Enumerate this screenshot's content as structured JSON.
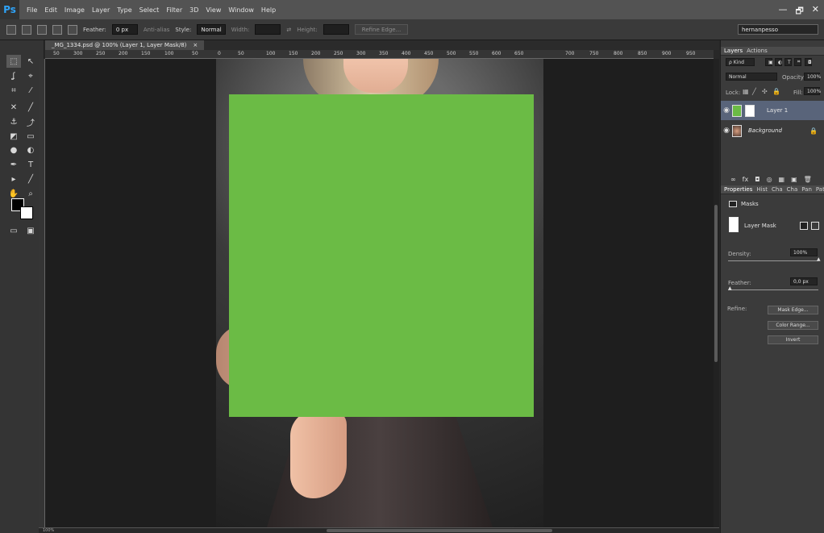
{
  "app": {
    "logo": "Ps",
    "menu": [
      "File",
      "Edit",
      "Image",
      "Layer",
      "Type",
      "Select",
      "Filter",
      "3D",
      "View",
      "Window",
      "Help"
    ],
    "window_controls": [
      "—",
      "🗗",
      "✕"
    ]
  },
  "options_bar": {
    "feather_label": "Feather:",
    "feather_value": "0 px",
    "anti_alias": "Anti-alias",
    "style_label": "Style:",
    "style_value": "Normal",
    "width_label": "Width:",
    "height_label": "Height:",
    "refine_edge": "Refine Edge...",
    "workspace": "hernanpesso"
  },
  "document": {
    "tab_title": "_MG_1334.psd @ 100% (Layer 1, Layer Mask/8)",
    "close": "×",
    "ruler_ticks": [
      "50",
      "300",
      "250",
      "200",
      "150",
      "100",
      "50",
      "0",
      "50",
      "100",
      "150",
      "200",
      "250",
      "300",
      "350",
      "400",
      "450",
      "500",
      "550",
      "600",
      "650",
      "700",
      "750",
      "800",
      "850",
      "900",
      "950"
    ],
    "status": "100%"
  },
  "tools": [
    {
      "icon": "rectangular-marquee-icon",
      "glyph": "⬚"
    },
    {
      "icon": "move-icon",
      "glyph": "↖"
    },
    {
      "icon": "lasso-icon",
      "glyph": "ʆ"
    },
    {
      "icon": "quick-selection-icon",
      "glyph": "⌖"
    },
    {
      "icon": "crop-icon",
      "glyph": "⌗"
    },
    {
      "icon": "eyedropper-icon",
      "glyph": "⁄"
    },
    {
      "icon": "spot-healing-icon",
      "glyph": "✕"
    },
    {
      "icon": "brush-icon",
      "glyph": "╱"
    },
    {
      "icon": "clone-stamp-icon",
      "glyph": "⚓"
    },
    {
      "icon": "history-brush-icon",
      "glyph": "⤴"
    },
    {
      "icon": "eraser-icon",
      "glyph": "◩"
    },
    {
      "icon": "gradient-icon",
      "glyph": "▭"
    },
    {
      "icon": "blur-icon",
      "glyph": "●"
    },
    {
      "icon": "dodge-icon",
      "glyph": "◐"
    },
    {
      "icon": "pen-icon",
      "glyph": "✒"
    },
    {
      "icon": "type-icon",
      "glyph": "T"
    },
    {
      "icon": "path-selection-icon",
      "glyph": "▸"
    },
    {
      "icon": "line-icon",
      "glyph": "╱"
    },
    {
      "icon": "hand-icon",
      "glyph": "✋"
    },
    {
      "icon": "zoom-icon",
      "glyph": "⌕"
    }
  ],
  "layers_panel": {
    "tabs": [
      "Layers",
      "Actions"
    ],
    "kind": "ρ Kind",
    "blend_mode": "Normal",
    "opacity_label": "Opacity:",
    "opacity_value": "100%",
    "lock_label": "Lock:",
    "fill_label": "Fill:",
    "fill_value": "100%",
    "layers": [
      {
        "name": "Layer 1",
        "selected": true,
        "eye": "◉"
      },
      {
        "name": "Background",
        "selected": false,
        "eye": "◉",
        "lock": "🔒"
      }
    ],
    "bottom_icons": [
      "∞",
      "fx",
      "◘",
      "◎",
      "▦",
      "▣",
      "🗑"
    ]
  },
  "properties_panel": {
    "tabs": [
      "Properties",
      "Hist",
      "Cha",
      "Cha",
      "Pan",
      "Path"
    ],
    "section_title": "Masks",
    "mask_label": "Layer Mask",
    "density_label": "Density:",
    "density_value": "100%",
    "feather_label": "Feather:",
    "feather_value": "0,0 px",
    "refine_label": "Refine:",
    "mask_edge_button": "Mask Edge...",
    "color_range_button": "Color Range...",
    "invert_button": "Invert"
  },
  "colors": {
    "overlay_green": "#6bbb45",
    "panel_selection": "#59647a",
    "ps_blue": "#2fa3f7"
  }
}
